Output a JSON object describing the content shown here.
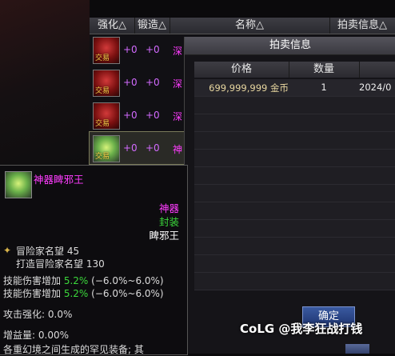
{
  "list_headers": [
    "强化△",
    "锻造△",
    "名称△",
    "拍卖信息△"
  ],
  "rows": [
    {
      "tag": "交易",
      "v1": "+0",
      "v2": "+0",
      "name": "深"
    },
    {
      "tag": "交易",
      "v1": "+0",
      "v2": "+0",
      "name": "深"
    },
    {
      "tag": "交易",
      "v1": "+0",
      "v2": "+0",
      "name": "深"
    },
    {
      "tag": "交易",
      "v1": "+0",
      "v2": "+0",
      "name": "神"
    }
  ],
  "panel": {
    "title": "拍卖信息",
    "headers": [
      "价格",
      "数量",
      ""
    ],
    "row": {
      "price": "699,999,999 金币",
      "qty": "1",
      "date": "2024/0"
    },
    "ok_label": "确定"
  },
  "tooltip": {
    "name": "神器睥邪王",
    "type": "神器",
    "seal": "封装",
    "set": "睥邪王",
    "fame_label": "冒险家名望",
    "fame_value": "45",
    "forge_fame_label": "打造冒险家名望",
    "forge_fame_value": "130",
    "skill1_label": "技能伤害增加",
    "skill1_value": "5.2%",
    "skill1_range": "(−6.0%~6.0%)",
    "skill2_label": "技能伤害增加",
    "skill2_value": "5.2%",
    "skill2_range": "(−6.0%~6.0%)",
    "atk_label": "攻击强化:",
    "atk_value": "0.0%",
    "gain_label": "增益量:",
    "gain_value": "0.00%",
    "desc": "各重幻境之间生成的罕见装备; 其"
  },
  "watermark": "CoLG @我李狂战打钱"
}
